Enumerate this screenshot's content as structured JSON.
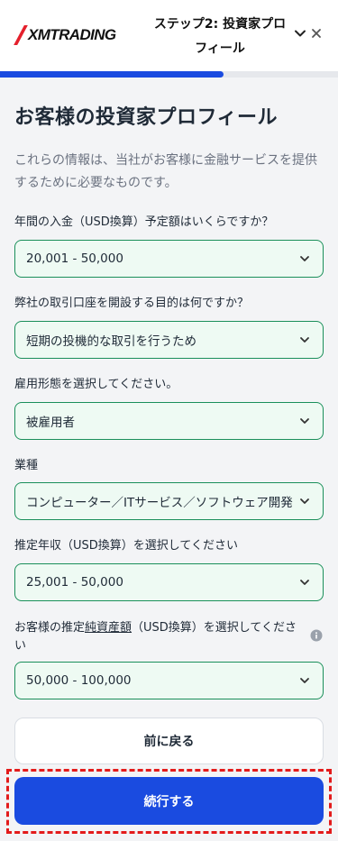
{
  "header": {
    "logo_text": "XMTRADING",
    "step_title": "ステップ2: 投資家プロフィール"
  },
  "progress": {
    "fraction": 0.66
  },
  "page": {
    "title": "お客様の投資家プロフィール",
    "description": "これらの情報は、当社がお客様に金融サービスを提供するために必要なものです。"
  },
  "fields": [
    {
      "label": "年間の入金（USD換算）予定額はいくらですか？",
      "value": "20,001 - 50,000"
    },
    {
      "label": "弊社の取引口座を開設する目的は何ですか？",
      "value": "短期の投機的な取引を行うため"
    },
    {
      "label": "雇用形態を選択してください。",
      "value": "被雇用者"
    },
    {
      "label": "業種",
      "value": "コンピューター／ITサービス／ソフトウェア開発"
    },
    {
      "label": "推定年収（USD換算）を選択してください",
      "value": "25,001 - 50,000"
    },
    {
      "label_prefix": "お客様の推定",
      "label_underlined": "純資産額",
      "label_suffix": "（USD換算）を選択してください",
      "value": "50,000 - 100,000"
    }
  ],
  "buttons": {
    "back": "前に戻る",
    "continue": "続行する"
  },
  "colors": {
    "primary": "#1a4be0",
    "field_border": "#1a8f5a",
    "field_bg": "#eefaf3",
    "highlight": "#e31b1b"
  },
  "icons": [
    "chevron-down-icon",
    "close-icon",
    "info-icon"
  ]
}
